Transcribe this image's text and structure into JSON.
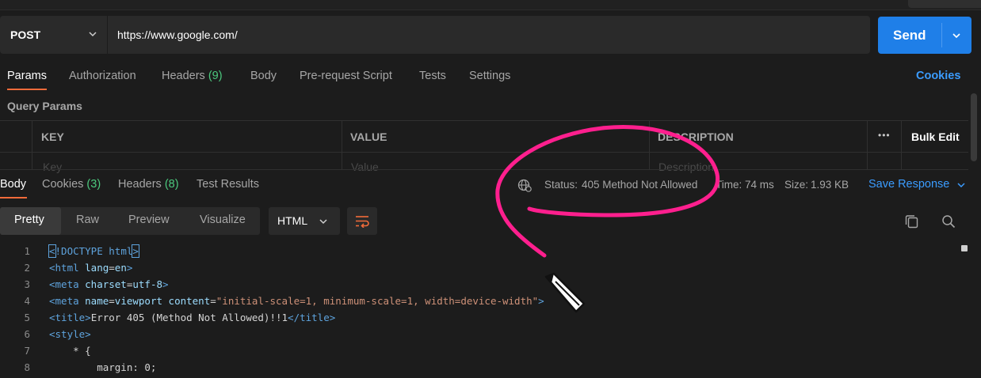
{
  "request": {
    "method": "POST",
    "url": "https://www.google.com/",
    "send_label": "Send"
  },
  "request_tabs": [
    {
      "label": "Params"
    },
    {
      "label": "Authorization"
    },
    {
      "label": "Headers",
      "count": "(9)"
    },
    {
      "label": "Body"
    },
    {
      "label": "Pre-request Script"
    },
    {
      "label": "Tests"
    },
    {
      "label": "Settings"
    }
  ],
  "cookies_link": "Cookies",
  "query_params": {
    "title": "Query Params",
    "columns": [
      "KEY",
      "VALUE",
      "DESCRIPTION"
    ],
    "bulk_edit": "Bulk Edit",
    "more": "•••",
    "placeholders": {
      "key": "Key",
      "value": "Value",
      "description": "Description"
    }
  },
  "response_tabs": [
    {
      "label": "Body"
    },
    {
      "label": "Cookies",
      "count": "(3)"
    },
    {
      "label": "Headers",
      "count": "(8)"
    },
    {
      "label": "Test Results"
    }
  ],
  "response_status": {
    "status_label": "Status:",
    "status_value": "405 Method Not Allowed",
    "time_label": "Time:",
    "time_value": "74 ms",
    "size_label": "Size:",
    "size_value": "1.93 KB",
    "save_response": "Save Response"
  },
  "view_modes": [
    "Pretty",
    "Raw",
    "Preview",
    "Visualize"
  ],
  "language": "HTML",
  "code_lines": [
    {
      "n": "1",
      "parts": [
        [
          "tag",
          "<"
        ],
        [
          "tag",
          "!DOCTYPE html"
        ],
        [
          "tag",
          ">"
        ]
      ]
    },
    {
      "n": "2",
      "parts": [
        [
          "tag",
          "<html "
        ],
        [
          "attr",
          "lang"
        ],
        [
          "punc",
          "="
        ],
        [
          "attr",
          "en"
        ],
        [
          "tag",
          ">"
        ]
      ]
    },
    {
      "n": "3",
      "parts": [
        [
          "tag",
          "<meta "
        ],
        [
          "attr",
          "charset"
        ],
        [
          "punc",
          "="
        ],
        [
          "attr",
          "utf-8"
        ],
        [
          "tag",
          ">"
        ]
      ]
    },
    {
      "n": "4",
      "parts": [
        [
          "tag",
          "<meta "
        ],
        [
          "attr",
          "name"
        ],
        [
          "punc",
          "="
        ],
        [
          "attr",
          "viewport"
        ],
        [
          "txt",
          " "
        ],
        [
          "attr",
          "content"
        ],
        [
          "punc",
          "="
        ],
        [
          "str",
          "\"initial-scale=1, minimum-scale=1, width=device-width\""
        ],
        [
          "tag",
          ">"
        ]
      ]
    },
    {
      "n": "5",
      "parts": [
        [
          "tag",
          "<title>"
        ],
        [
          "txt",
          "Error 405 (Method Not Allowed)!!1"
        ],
        [
          "tag",
          "</title>"
        ]
      ]
    },
    {
      "n": "6",
      "parts": [
        [
          "tag",
          "<style>"
        ]
      ]
    },
    {
      "n": "7",
      "parts": [
        [
          "txt",
          "    * {"
        ]
      ]
    },
    {
      "n": "8",
      "parts": [
        [
          "txt",
          "        margin: 0;"
        ]
      ]
    }
  ],
  "colors": {
    "accent_blue": "#1f7fe8",
    "active_tab_underline": "#f26b3a",
    "success_green": "#4cc97e",
    "annotation_pink": "#ff1f8e"
  },
  "icons": {
    "method_dropdown": "chevron-down-icon",
    "send_dropdown": "chevron-down-icon",
    "status_globe": "globe-network-icon",
    "language_dropdown": "chevron-down-icon",
    "wrap_lines": "wrap-lines-icon",
    "copy": "copy-icon",
    "search": "search-icon",
    "annotation_pen": "pencil-cursor-icon"
  }
}
